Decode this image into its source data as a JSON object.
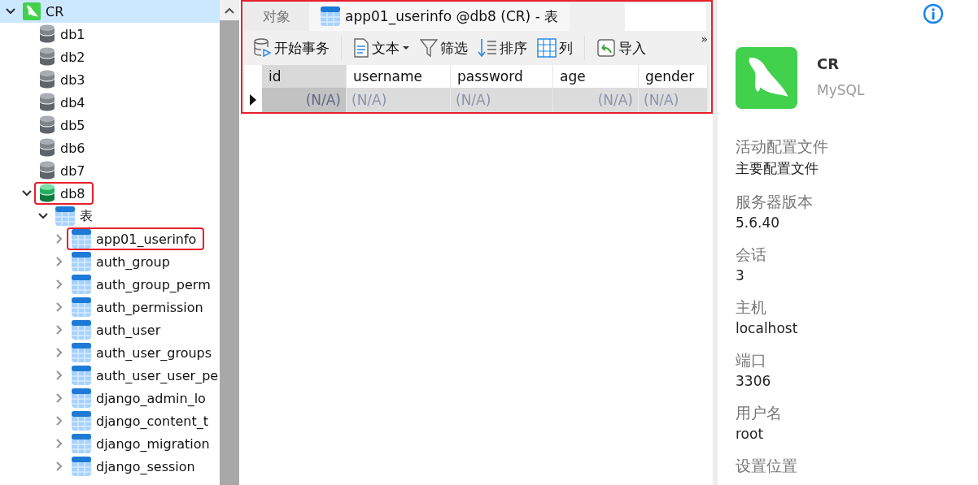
{
  "tree": [
    {
      "kind": "connection",
      "label": "CR",
      "selected": true,
      "expanded": true,
      "highlighted": false,
      "children": [
        {
          "kind": "database",
          "label": "db1",
          "open": false,
          "highlighted": false
        },
        {
          "kind": "database",
          "label": "db2",
          "open": false,
          "highlighted": false
        },
        {
          "kind": "database",
          "label": "db3",
          "open": false,
          "highlighted": false
        },
        {
          "kind": "database",
          "label": "db4",
          "open": false,
          "highlighted": false
        },
        {
          "kind": "database",
          "label": "db5",
          "open": false,
          "highlighted": false
        },
        {
          "kind": "database",
          "label": "db6",
          "open": false,
          "highlighted": false
        },
        {
          "kind": "database",
          "label": "db7",
          "open": false,
          "highlighted": false
        },
        {
          "kind": "database",
          "label": "db8",
          "open": true,
          "expanded": true,
          "highlighted": true,
          "children": [
            {
              "kind": "group",
              "label": "表",
              "expanded": true,
              "highlighted": false,
              "children": [
                {
                  "kind": "table",
                  "label": "app01_userinfo",
                  "expanded": false,
                  "highlighted": true
                },
                {
                  "kind": "table",
                  "label": "auth_group",
                  "expanded": false,
                  "highlighted": false
                },
                {
                  "kind": "table",
                  "label": "auth_group_perm",
                  "expanded": false,
                  "highlighted": false
                },
                {
                  "kind": "table",
                  "label": "auth_permission",
                  "expanded": false,
                  "highlighted": false
                },
                {
                  "kind": "table",
                  "label": "auth_user",
                  "expanded": false,
                  "highlighted": false
                },
                {
                  "kind": "table",
                  "label": "auth_user_groups",
                  "expanded": false,
                  "highlighted": false
                },
                {
                  "kind": "table",
                  "label": "auth_user_user_pe",
                  "expanded": false,
                  "highlighted": false
                },
                {
                  "kind": "table",
                  "label": "django_admin_lo",
                  "expanded": false,
                  "highlighted": false
                },
                {
                  "kind": "table",
                  "label": "django_content_t",
                  "expanded": false,
                  "highlighted": false
                },
                {
                  "kind": "table",
                  "label": "django_migration",
                  "expanded": false,
                  "highlighted": false
                },
                {
                  "kind": "table",
                  "label": "django_session",
                  "expanded": false,
                  "highlighted": false
                }
              ]
            }
          ]
        }
      ]
    }
  ],
  "editor": {
    "highlighted": true,
    "tabs": [
      {
        "label": "对象",
        "selected": false,
        "kind": "plain"
      },
      {
        "label": "app01_userinfo @db8 (CR) - 表",
        "selected": true,
        "kind": "table"
      }
    ],
    "toolbar": [
      {
        "label": "开始事务",
        "kind": "button"
      },
      {
        "label": "文本",
        "kind": "dropdown"
      },
      {
        "label": "筛选",
        "kind": "button"
      },
      {
        "label": "排序",
        "kind": "button"
      },
      {
        "label": "列",
        "kind": "button"
      },
      {
        "label": "导入",
        "kind": "button"
      }
    ],
    "overflow": "»",
    "columns": [
      {
        "label": "id",
        "kind": "number",
        "selected": true
      },
      {
        "label": "username",
        "kind": "text",
        "selected": false
      },
      {
        "label": "password",
        "kind": "text",
        "selected": false
      },
      {
        "label": "age",
        "kind": "number",
        "selected": false
      },
      {
        "label": "gender",
        "kind": "text",
        "selected": false
      }
    ],
    "rows": [
      {
        "current": true,
        "cells": [
          "(N/A)",
          "(N/A)",
          "(N/A)",
          "(N/A)",
          "(N/A)"
        ]
      }
    ]
  },
  "info": {
    "name": "CR",
    "type": "MySQL",
    "fields": [
      {
        "label": "活动配置文件",
        "value": "主要配置文件"
      },
      {
        "label": "服务器版本",
        "value": "5.6.40"
      },
      {
        "label": "会话",
        "value": "3"
      },
      {
        "label": "主机",
        "value": "localhost"
      },
      {
        "label": "端口",
        "value": "3306"
      },
      {
        "label": "用户名",
        "value": "root"
      },
      {
        "label": "设置位置"
      }
    ]
  }
}
